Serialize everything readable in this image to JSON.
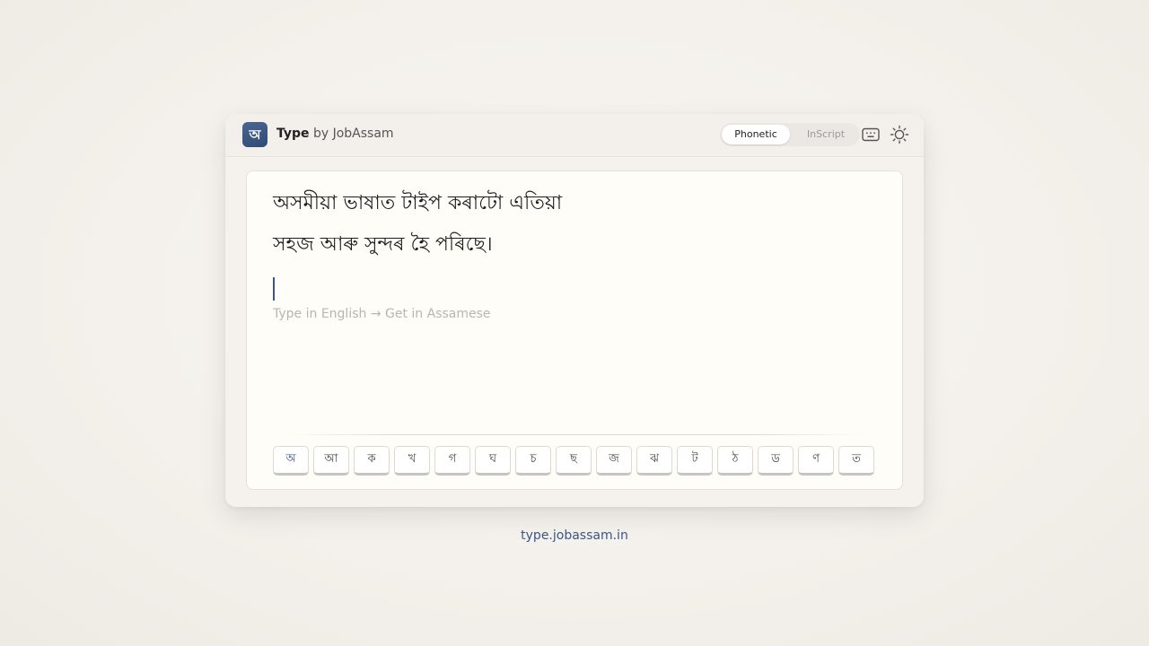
{
  "header": {
    "logo_glyph": "অ",
    "brand_primary": "Type",
    "brand_secondary": " by JobAssam",
    "modes": {
      "active": "Phonetic",
      "inactive": "InScript"
    },
    "icons": {
      "keyboard": "keyboard-icon",
      "theme": "sun-icon"
    }
  },
  "editor": {
    "lines": [
      "অসমীয়া ভাষাত টাইপ কৰাটো এতিয়া",
      "সহজ আৰু সুন্দৰ হৈ পৰিছে।"
    ],
    "placeholder": "Type in English → Get in Assamese"
  },
  "keyboard": {
    "keys": [
      "অ",
      "আ",
      "ক",
      "খ",
      "গ",
      "ঘ",
      "চ",
      "ছ",
      "জ",
      "ঝ",
      "ট",
      "ঠ",
      "ড",
      "ণ",
      "ত"
    ]
  },
  "footer": {
    "link_text": "type.jobassam.in"
  },
  "colors": {
    "accent": "#3b5686",
    "editor_bg": "#fefdf8"
  }
}
